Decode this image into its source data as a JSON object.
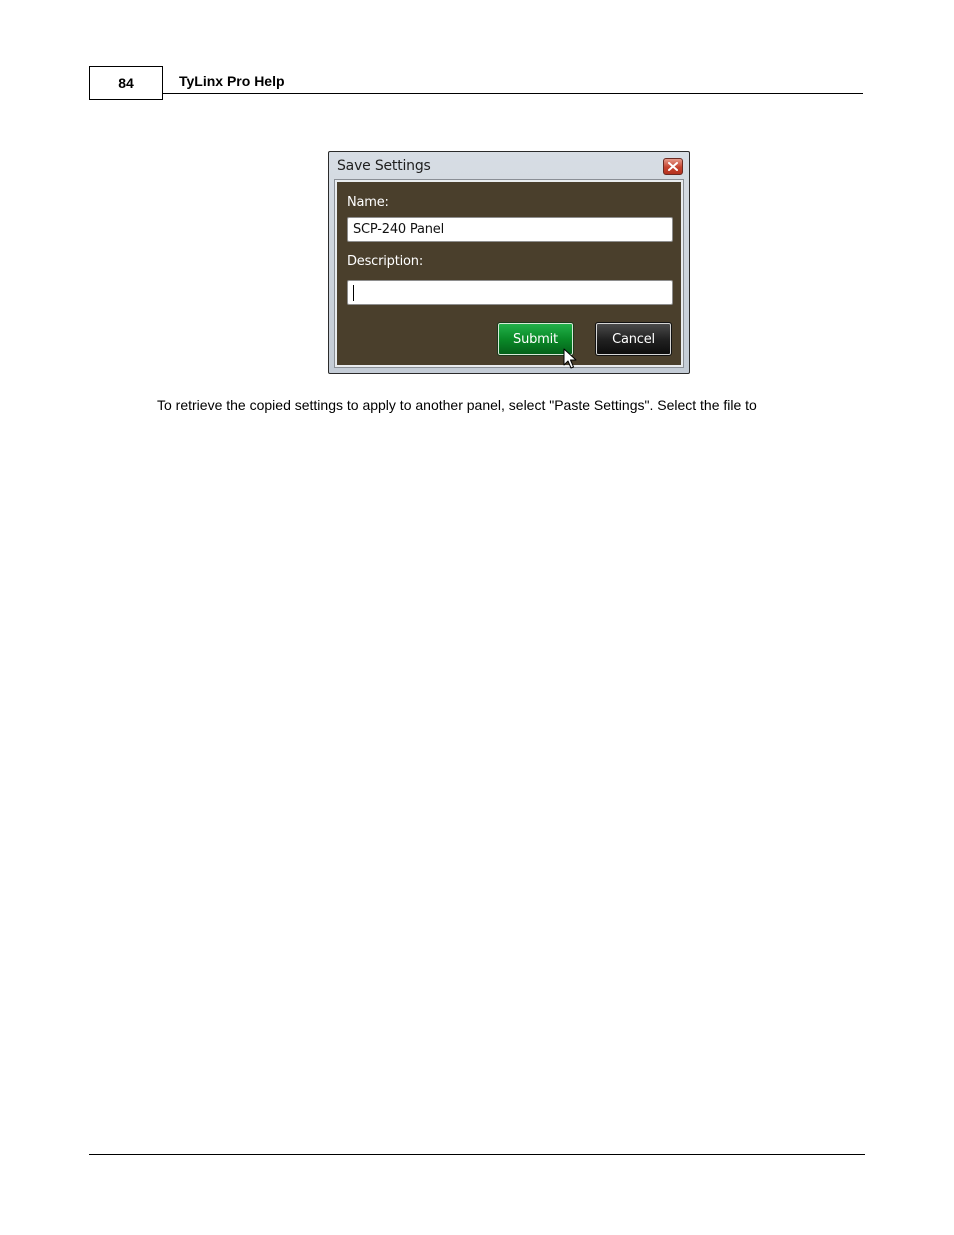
{
  "header": {
    "page_number": "84",
    "title": "TyLinx Pro Help"
  },
  "dialog": {
    "title": "Save Settings",
    "name_label": "Name:",
    "name_value": "SCP-240 Panel",
    "description_label": "Description:",
    "description_value": "",
    "submit_label": "Submit",
    "cancel_label": "Cancel",
    "colors": {
      "body_background": "#4a3f2c",
      "submit_green": "#0a8a28",
      "cancel_black": "#222222",
      "close_red": "#c5432f"
    },
    "icons": {
      "close": "close-icon",
      "cursor": "mouse-pointer-icon"
    }
  },
  "body": {
    "paragraph": "To retrieve the copied settings to apply to another panel, select \"Paste Settings\". Select the file to"
  }
}
